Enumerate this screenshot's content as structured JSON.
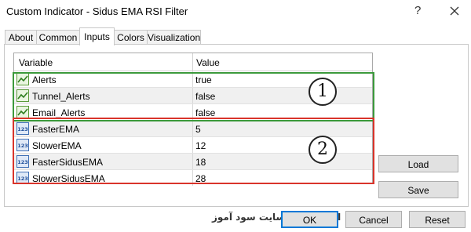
{
  "window": {
    "title": "Custom Indicator - Sidus EMA RSI Filter",
    "help_glyph": "?"
  },
  "tabs": [
    {
      "label": "About"
    },
    {
      "label": "Common"
    },
    {
      "label": "Inputs",
      "active": true
    },
    {
      "label": "Colors"
    },
    {
      "label": "Visualization"
    }
  ],
  "grid": {
    "headers": {
      "variable": "Variable",
      "value": "Value"
    },
    "rows": [
      {
        "variable": "Alerts",
        "value": "true",
        "icon": "bool-chart-icon"
      },
      {
        "variable": "Tunnel_Alerts",
        "value": "false",
        "icon": "bool-chart-icon"
      },
      {
        "variable": "Email_Alerts",
        "value": "false",
        "icon": "bool-chart-icon"
      },
      {
        "variable": "FasterEMA",
        "value": "5",
        "icon": "int-123-icon"
      },
      {
        "variable": "SlowerEMA",
        "value": "12",
        "icon": "int-123-icon"
      },
      {
        "variable": "FasterSidusEMA",
        "value": "18",
        "icon": "int-123-icon"
      },
      {
        "variable": "SlowerSidusEMA",
        "value": "28",
        "icon": "int-123-icon"
      }
    ]
  },
  "annotations": {
    "callout_1": "1",
    "callout_2": "2",
    "group_1_color": "#3c9a3c",
    "group_2_color": "#d9342b"
  },
  "buttons": {
    "load": "Load",
    "save": "Save",
    "ok": "OK",
    "cancel": "Cancel",
    "reset": "Reset"
  },
  "watermark": "انتشار در وبسایت سود آموز"
}
